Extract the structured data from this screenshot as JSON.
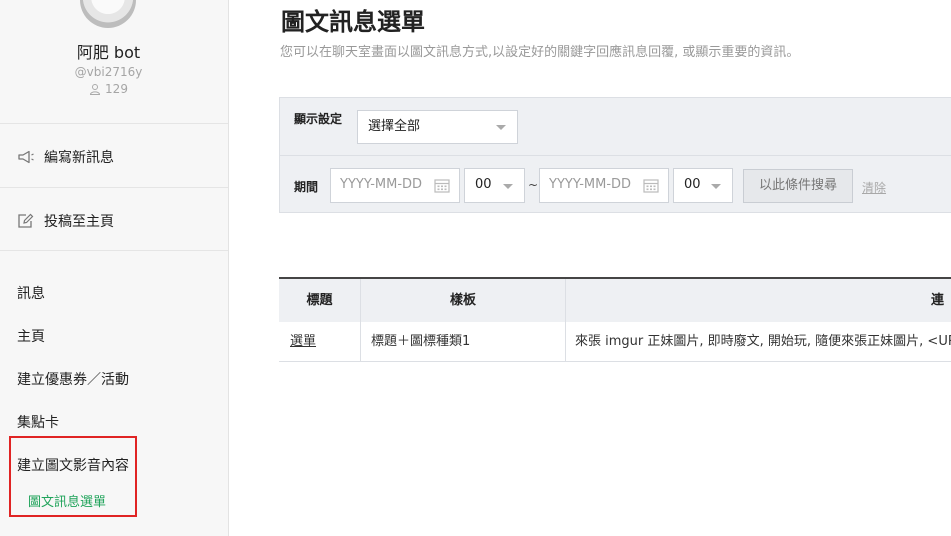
{
  "sidebar": {
    "account_name": "阿肥 bot",
    "account_id": "@vbi2716y",
    "followers": "129",
    "actions": [
      {
        "label": "編寫新訊息",
        "icon": "megaphone-icon"
      },
      {
        "label": "投稿至主頁",
        "icon": "edit-icon"
      }
    ],
    "nav": {
      "messages": "訊息",
      "home": "主頁",
      "coupons": "建立優惠券／活動",
      "rewards": "集點卡",
      "rich_content": "建立圖文影音內容",
      "rich_menu_sub": "圖文訊息選單"
    },
    "highlight_color": "#e02424",
    "active_color": "#1fa35a"
  },
  "main": {
    "title": "圖文訊息選單",
    "description": "您可以在聊天室畫面以圖文訊息方式,以設定好的關鍵字回應訊息回覆, 或顯示重要的資訊。"
  },
  "filter": {
    "display_label": "顯示設定",
    "display_value": "選擇全部",
    "period_label": "期間",
    "start_date_placeholder": "YYYY-MM-DD",
    "start_hour": "00",
    "tilde": "~",
    "end_date_placeholder": "YYYY-MM-DD",
    "end_hour": "00",
    "search_button": "以此條件搜尋",
    "clear_link": "清除"
  },
  "table": {
    "headers": [
      "標題",
      "樣板",
      "連"
    ],
    "rows": [
      {
        "title": "選單",
        "template": "標題＋圖標種類1",
        "content": "來張 imgur 正妹圖片, 即時廢文, 開始玩, 隨便來張正妹圖片, <URL"
      }
    ]
  }
}
